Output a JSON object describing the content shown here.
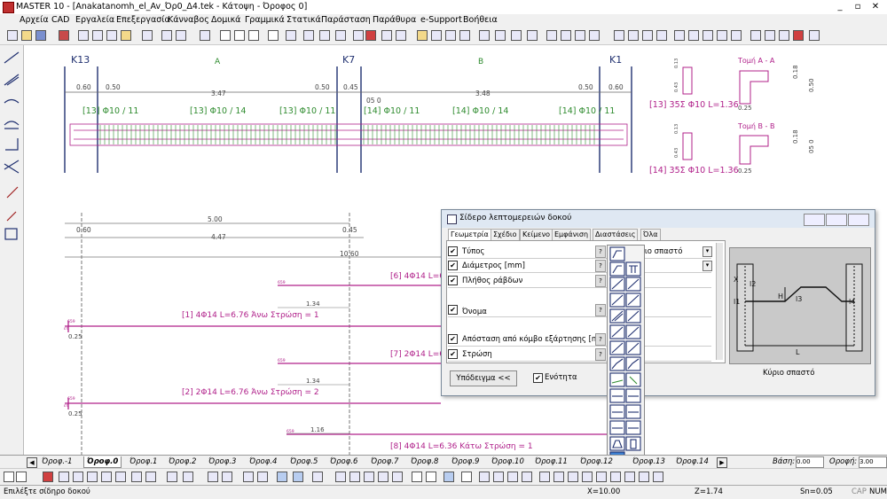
{
  "app": {
    "title": "MASTER 10 - [Anakatanomh_el_Av_Όρ0_Δ4.tek - Κάτοψη - Όροφος 0]",
    "window_buttons": [
      "_",
      "▫",
      "✕"
    ]
  },
  "menu": [
    "Αρχεία",
    "CAD",
    "Εργαλεία",
    "Επεξεργασία",
    "Κάνναβος",
    "Δομικά",
    "Γραμμικά",
    "Στατικά",
    "Παράσταση",
    "Παράθυρα",
    "e-Support",
    "Βοήθεια"
  ],
  "drawing": {
    "column_labels": [
      "K13",
      "A",
      "K7",
      "B",
      "K1"
    ],
    "dims_top": [
      "0.60",
      "0.50",
      "3.47",
      "0.50",
      "0.45",
      "3.48",
      "0.50",
      "0.60"
    ],
    "dim_small": "05 0",
    "bar_labels": [
      "[13] Φ10 / 11",
      "[13] Φ10 / 14",
      "[13] Φ10 / 11",
      "[14] Φ10 / 11",
      "[14] Φ10 / 14",
      "[14] Φ10 / 11"
    ],
    "stirrup_labels": [
      "[13] 35Σ Φ10 L=1.36",
      "[14] 35Σ Φ10 L=1.36"
    ],
    "section_titles": [
      "Τομή A - A",
      "Τομή B - B"
    ],
    "section_dims": [
      "0.18",
      "0.50",
      "0.25",
      "0.18",
      "05 0",
      "0.25"
    ],
    "stirrup_dims": [
      "0.13",
      "0.43",
      "0.13",
      "0.43"
    ],
    "lower_dims": [
      "5.00",
      "0.60",
      "0.45",
      "4.47",
      "10.60"
    ],
    "rebar_labels": [
      "[6] 4Φ14 L=6",
      "[1] 4Φ14 L=6.76 Άνω Στρώση = 1",
      "[7] 2Φ14 L=6",
      "[2] 2Φ14 L=6.76 Άνω Στρώση = 2",
      "[8] 4Φ14 L=6.36 Κάτω Στρώση = 1"
    ],
    "rebar_dims": [
      "1.34",
      "1.34",
      "1.16",
      "0.25",
      "0.25"
    ],
    "small_marks": [
      "659",
      "659",
      "659",
      "659",
      "659",
      "ετ",
      "ετ"
    ]
  },
  "dialog": {
    "title": "Σίδερο λεπτομερειών δοκού",
    "tabs": [
      "Γεωμετρία",
      "Σχέδιο",
      "Κείμενο",
      "Εμφάνιση",
      "Διαστάσεις",
      "Όλα"
    ],
    "rows": [
      {
        "label": "Τύπος",
        "checked": true,
        "value": "Κύριο σπαστό",
        "dropdown": true
      },
      {
        "label": "Διάμετρος [mm]",
        "checked": true,
        "value": "",
        "dropdown": true
      },
      {
        "label": "Πλήθος ράβδων",
        "checked": true,
        "value": "",
        "dropdown": false
      },
      {
        "label": "Όνομα",
        "checked": true,
        "value": "",
        "dropdown": false
      },
      {
        "label": "Απόσταση από κόμβο εξάρτησης [m]",
        "checked": true,
        "value": "",
        "dropdown": false
      },
      {
        "label": "Στρώση",
        "checked": true,
        "value": "",
        "dropdown": false
      }
    ],
    "footer_button": "Υπόδειγμα <<",
    "checkbox_unity": "Ενότητα",
    "checkbox_unity_checked": true,
    "preview_caption": "Κύριο σπαστό",
    "preview_labels": [
      "X",
      "l2",
      "H",
      "l3",
      "l1",
      "l4",
      "L"
    ]
  },
  "floor_tabs": [
    "Όροφ.-1",
    "Όροφ.0",
    "Όροφ.1",
    "Όροφ.2",
    "Όροφ.3",
    "Όροφ.4",
    "Όροφ.5",
    "Όροφ.6",
    "Όροφ.7",
    "Όροφ.8",
    "Όροφ.9",
    "Όροφ.10",
    "Όροφ.11",
    "Όροφ.12",
    "Όροφ.13",
    "Όροφ.14"
  ],
  "active_floor": "Όροφ.0",
  "base": {
    "label": "Βάση:",
    "value": "0.00"
  },
  "roof": {
    "label": "Οροφή:",
    "value": "3.00"
  },
  "status": {
    "message": "Επιλέξτε σίδηρο δοκού",
    "x": "X=10.00",
    "z": "Z=1.74",
    "sn": "Sn=0.05",
    "flags": [
      "CAP",
      "NUM"
    ]
  },
  "colors": {
    "green": "#2e8b2e",
    "magenta": "#b0208a",
    "navy": "#203070",
    "accent_blue": "#3c7fd0"
  }
}
